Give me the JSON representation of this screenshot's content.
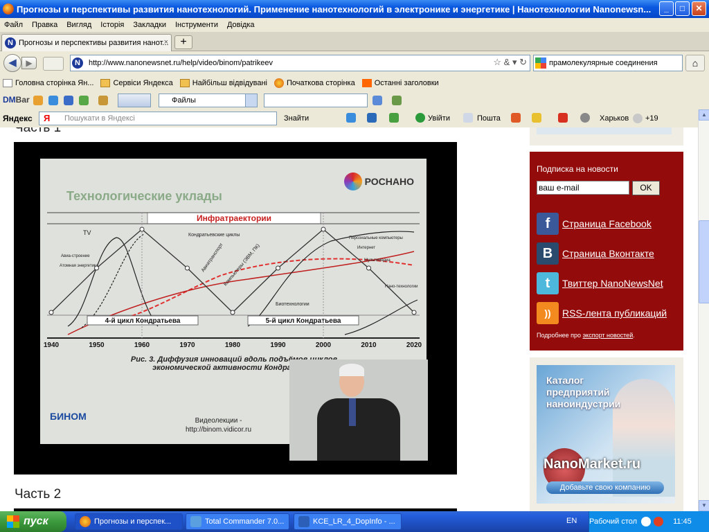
{
  "window": {
    "title": "Прогнозы и перспективы развития нанотехнологий. Применение нанотехнологий в электронике и энергетике | Нанотехнологии Nanonewsn...",
    "btn_min": "_",
    "btn_max": "□",
    "btn_close": "✕"
  },
  "menu": [
    "Файл",
    "Правка",
    "Вигляд",
    "Історія",
    "Закладки",
    "Інструменти",
    "Довідка"
  ],
  "tab": {
    "title": "Прогнозы и перспективы развития нанот...",
    "close": "×",
    "new_tab": "+"
  },
  "nav": {
    "url": "http://www.nanonewsnet.ru/help/video/binom/patrikeev",
    "search_value": "прамолекулярные соединения",
    "back": "◀",
    "fwd": "▶",
    "home": "⌂"
  },
  "bookmarks": [
    {
      "label": "Головна сторінка Ян...",
      "icon": "doc"
    },
    {
      "label": "Сервіси Яндекса",
      "icon": "folder"
    },
    {
      "label": "Найбільш відвідувані",
      "icon": "folder"
    },
    {
      "label": "Початкова сторінка",
      "icon": "ff"
    },
    {
      "label": "Останні заголовки",
      "icon": "rss"
    }
  ],
  "dmbar": {
    "logo_a": "DM",
    "logo_b": "Bar",
    "files": "Файлы"
  },
  "yandex": {
    "logo": "Яндекс",
    "search_placeholder": "Пошукати в Яндексі",
    "find": "Знайти",
    "login": "Увійти",
    "mail": "Пошта",
    "city": "Харьков",
    "temp": "+19"
  },
  "content": {
    "part1": "Часть 1",
    "part2": "Часть 2",
    "slide": {
      "logo": "РОСНАНО",
      "title": "Технологические уклады",
      "banner": "Инфратраектории",
      "caption1": "Рис. 3. Диффузия инноваций вдоль подъёмов циклов",
      "caption2": "экономической активности Кондратьева",
      "cycle4": "4-й цикл Кондратьева",
      "cycle5": "5-й цикл Кондратьева",
      "binom_logo": "БИНОМ",
      "lectures": "Видеолекции -",
      "lectures_url": "http://binom.vidicor.ru",
      "curve_labels": [
        "TV",
        "Авиа-строение",
        "Атомная энергетика",
        "Кондратьевские циклы",
        "Авиатранспорт",
        "Компьютеры (ЭВМ, ПК)",
        "Персональные компьютеры",
        "Интернет",
        "Мультимедиа",
        "Биотехнологии",
        "Нано-технологии"
      ]
    },
    "chart_data": {
      "type": "line",
      "title": "Технологические уклады",
      "x": [
        1940,
        1950,
        1960,
        1970,
        1980,
        1990,
        2000,
        2010,
        2020
      ],
      "xlim": [
        1940,
        2020
      ],
      "series": [
        {
          "name": "Кондратьевские циклы",
          "x": [
            1940,
            1950,
            1960,
            1970,
            1980,
            1990,
            2000,
            2010,
            2020
          ],
          "values": [
            0.2,
            0.6,
            0.95,
            0.6,
            0.2,
            0.6,
            0.95,
            0.6,
            0.2
          ]
        }
      ]
    }
  },
  "sidebar": {
    "subscribe_title": "Подписка на новости",
    "email_placeholder": "ваш e-mail",
    "ok": "OK",
    "links": [
      {
        "label": "Страница Facebook",
        "icon": "f",
        "color": "#3b5998"
      },
      {
        "label": "Страница Вконтакте",
        "icon": "B",
        "color": "#2a4a6e"
      },
      {
        "label": "Твиттер NanoNewsNet",
        "icon": "t",
        "color": "#4db8dc"
      },
      {
        "label": "RSS-лента публикаций",
        "icon": "))",
        "color": "#f28a20"
      }
    ],
    "note_prefix": "Подробнее про ",
    "note_link": "экспорт новостей",
    "ad": {
      "title1": "Каталог",
      "title2": "предприятий",
      "title3": "наноиндустрии",
      "name": "NanoMarket.ru",
      "button": "Добавьте свою компанию"
    }
  },
  "taskbar": {
    "start": "пуск",
    "tasks": [
      {
        "label": "Прогнозы и перспек...",
        "active": true
      },
      {
        "label": "Total Commander 7.0...",
        "active": false
      },
      {
        "label": "KCE_LR_4_DopInfo - ...",
        "active": false
      }
    ],
    "lang": "EN",
    "desktop": "Рабочий стол",
    "time": "11:45"
  },
  "colors": {
    "accent_red": "#930b0b",
    "xp_blue": "#245edc"
  }
}
